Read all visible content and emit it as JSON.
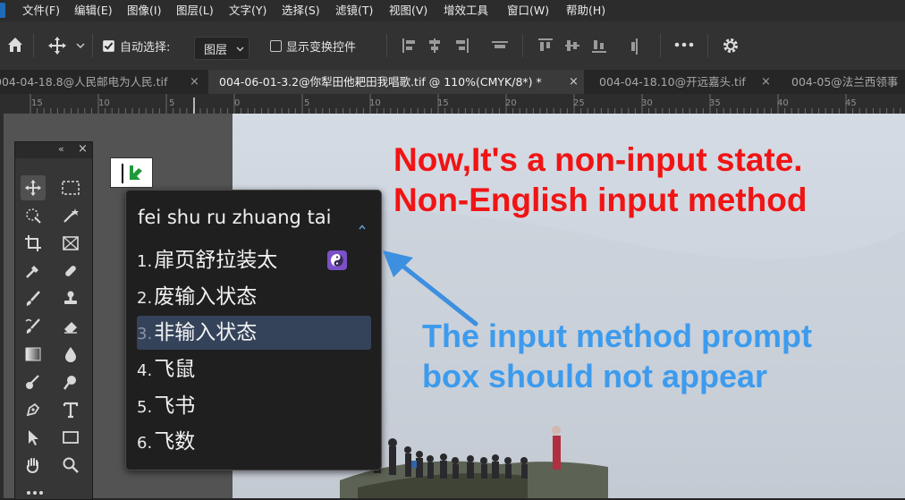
{
  "menubar": {
    "items": [
      "文件(F)",
      "编辑(E)",
      "图像(I)",
      "图层(L)",
      "文字(Y)",
      "选择(S)",
      "滤镜(T)",
      "视图(V)",
      "增效工具",
      "窗口(W)",
      "帮助(H)"
    ]
  },
  "options": {
    "auto_select_label": "自动选择:",
    "auto_select_checked": true,
    "layer_select_value": "图层",
    "show_transform_label": "显示变换控件",
    "show_transform_checked": false
  },
  "tabs": [
    {
      "label": "004-04-18.8@人民邮电为人民.tif",
      "active": false
    },
    {
      "label": "004-06-01-3.2@你犁田他耙田我唱歌.tif @ 110%(CMYK/8*) *",
      "active": true
    },
    {
      "label": "004-04-18.10@开远嘉头.tif",
      "active": false
    },
    {
      "label": "004-05@法兰西领事",
      "active": false
    }
  ],
  "ruler": {
    "labels": [
      "15",
      "10",
      "5",
      "0",
      "5",
      "10",
      "15",
      "20",
      "25",
      "30",
      "35",
      "40",
      "45"
    ]
  },
  "toolbox": {
    "header_collapse": "«",
    "header_close": "×"
  },
  "ime": {
    "pinyin": "fei shu ru zhuang tai",
    "candidates": [
      {
        "num": "1.",
        "text": "扉页舒拉装太",
        "highlighted": false
      },
      {
        "num": "2.",
        "text": "废输入状态",
        "highlighted": false
      },
      {
        "num": "3.",
        "text": "非输入状态",
        "highlighted": true
      },
      {
        "num": "4.",
        "text": "飞鼠",
        "highlighted": false
      },
      {
        "num": "5.",
        "text": "飞书",
        "highlighted": false
      },
      {
        "num": "6.",
        "text": "飞数",
        "highlighted": false
      }
    ]
  },
  "annotations": {
    "red_line1": "Now,It's a non-input state.",
    "red_line2": "Non-English input method",
    "blue_line1": "The input method prompt",
    "blue_line2": "box should not appear",
    "red_color": "#f01414",
    "blue_color": "#3d9bed"
  },
  "colors": {
    "app_bg": "#262626",
    "panel": "#323232",
    "ime_highlight": "#34435a"
  }
}
